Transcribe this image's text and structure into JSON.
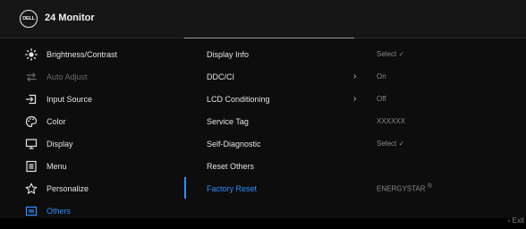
{
  "header": {
    "logo_text": "DELL",
    "title": "24 Monitor"
  },
  "menu": {
    "items": [
      {
        "label": "Brightness/Contrast",
        "icon": "brightness-icon",
        "state": "normal"
      },
      {
        "label": "Auto Adjust",
        "icon": "auto-adjust-icon",
        "state": "disabled"
      },
      {
        "label": "Input Source",
        "icon": "input-source-icon",
        "state": "normal"
      },
      {
        "label": "Color",
        "icon": "color-palette-icon",
        "state": "normal"
      },
      {
        "label": "Display",
        "icon": "display-icon",
        "state": "normal"
      },
      {
        "label": "Menu",
        "icon": "menu-icon",
        "state": "normal"
      },
      {
        "label": "Personalize",
        "icon": "star-icon",
        "state": "normal"
      },
      {
        "label": "Others",
        "icon": "others-icon",
        "state": "active"
      }
    ]
  },
  "submenu": {
    "items": [
      {
        "label": "Display Info",
        "arrow": ""
      },
      {
        "label": "DDC/CI",
        "arrow": "›"
      },
      {
        "label": "LCD Conditioning",
        "arrow": "›"
      },
      {
        "label": "Service Tag",
        "arrow": ""
      },
      {
        "label": "Self-Diagnostic",
        "arrow": ""
      },
      {
        "label": "Reset Others",
        "arrow": ""
      },
      {
        "label": "Factory Reset",
        "arrow": "",
        "active": true
      }
    ]
  },
  "values": {
    "items": [
      {
        "text": "Select ✓"
      },
      {
        "text": "On"
      },
      {
        "text": "Off"
      },
      {
        "text": "XXXXXX"
      },
      {
        "text": "Select ✓"
      },
      {
        "text": ""
      },
      {
        "text": "ENERGYSTAR",
        "sup": "®"
      }
    ]
  },
  "footer": {
    "exit_label": "‹  Exit"
  },
  "colors": {
    "accent": "#2f8fff",
    "background": "#0d0d0d",
    "header": "#161616"
  }
}
